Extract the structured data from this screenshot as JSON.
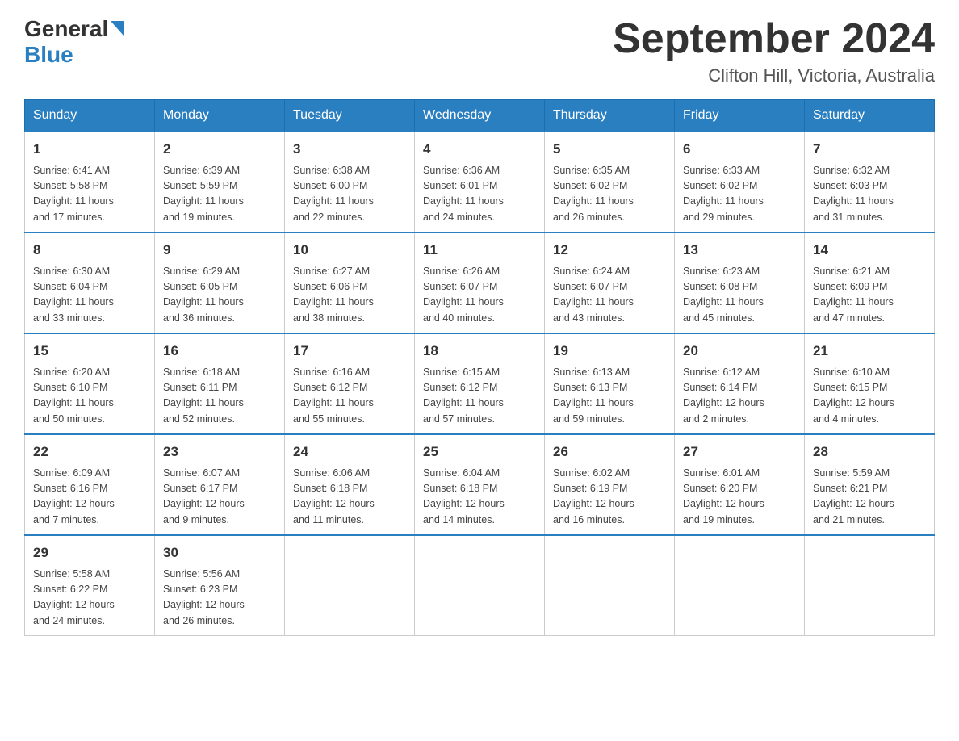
{
  "header": {
    "logo_general": "General",
    "logo_blue": "Blue",
    "month_title": "September 2024",
    "location": "Clifton Hill, Victoria, Australia"
  },
  "days_of_week": [
    "Sunday",
    "Monday",
    "Tuesday",
    "Wednesday",
    "Thursday",
    "Friday",
    "Saturday"
  ],
  "weeks": [
    [
      {
        "day": "1",
        "sunrise": "6:41 AM",
        "sunset": "5:58 PM",
        "daylight": "11 hours and 17 minutes."
      },
      {
        "day": "2",
        "sunrise": "6:39 AM",
        "sunset": "5:59 PM",
        "daylight": "11 hours and 19 minutes."
      },
      {
        "day": "3",
        "sunrise": "6:38 AM",
        "sunset": "6:00 PM",
        "daylight": "11 hours and 22 minutes."
      },
      {
        "day": "4",
        "sunrise": "6:36 AM",
        "sunset": "6:01 PM",
        "daylight": "11 hours and 24 minutes."
      },
      {
        "day": "5",
        "sunrise": "6:35 AM",
        "sunset": "6:02 PM",
        "daylight": "11 hours and 26 minutes."
      },
      {
        "day": "6",
        "sunrise": "6:33 AM",
        "sunset": "6:02 PM",
        "daylight": "11 hours and 29 minutes."
      },
      {
        "day": "7",
        "sunrise": "6:32 AM",
        "sunset": "6:03 PM",
        "daylight": "11 hours and 31 minutes."
      }
    ],
    [
      {
        "day": "8",
        "sunrise": "6:30 AM",
        "sunset": "6:04 PM",
        "daylight": "11 hours and 33 minutes."
      },
      {
        "day": "9",
        "sunrise": "6:29 AM",
        "sunset": "6:05 PM",
        "daylight": "11 hours and 36 minutes."
      },
      {
        "day": "10",
        "sunrise": "6:27 AM",
        "sunset": "6:06 PM",
        "daylight": "11 hours and 38 minutes."
      },
      {
        "day": "11",
        "sunrise": "6:26 AM",
        "sunset": "6:07 PM",
        "daylight": "11 hours and 40 minutes."
      },
      {
        "day": "12",
        "sunrise": "6:24 AM",
        "sunset": "6:07 PM",
        "daylight": "11 hours and 43 minutes."
      },
      {
        "day": "13",
        "sunrise": "6:23 AM",
        "sunset": "6:08 PM",
        "daylight": "11 hours and 45 minutes."
      },
      {
        "day": "14",
        "sunrise": "6:21 AM",
        "sunset": "6:09 PM",
        "daylight": "11 hours and 47 minutes."
      }
    ],
    [
      {
        "day": "15",
        "sunrise": "6:20 AM",
        "sunset": "6:10 PM",
        "daylight": "11 hours and 50 minutes."
      },
      {
        "day": "16",
        "sunrise": "6:18 AM",
        "sunset": "6:11 PM",
        "daylight": "11 hours and 52 minutes."
      },
      {
        "day": "17",
        "sunrise": "6:16 AM",
        "sunset": "6:12 PM",
        "daylight": "11 hours and 55 minutes."
      },
      {
        "day": "18",
        "sunrise": "6:15 AM",
        "sunset": "6:12 PM",
        "daylight": "11 hours and 57 minutes."
      },
      {
        "day": "19",
        "sunrise": "6:13 AM",
        "sunset": "6:13 PM",
        "daylight": "11 hours and 59 minutes."
      },
      {
        "day": "20",
        "sunrise": "6:12 AM",
        "sunset": "6:14 PM",
        "daylight": "12 hours and 2 minutes."
      },
      {
        "day": "21",
        "sunrise": "6:10 AM",
        "sunset": "6:15 PM",
        "daylight": "12 hours and 4 minutes."
      }
    ],
    [
      {
        "day": "22",
        "sunrise": "6:09 AM",
        "sunset": "6:16 PM",
        "daylight": "12 hours and 7 minutes."
      },
      {
        "day": "23",
        "sunrise": "6:07 AM",
        "sunset": "6:17 PM",
        "daylight": "12 hours and 9 minutes."
      },
      {
        "day": "24",
        "sunrise": "6:06 AM",
        "sunset": "6:18 PM",
        "daylight": "12 hours and 11 minutes."
      },
      {
        "day": "25",
        "sunrise": "6:04 AM",
        "sunset": "6:18 PM",
        "daylight": "12 hours and 14 minutes."
      },
      {
        "day": "26",
        "sunrise": "6:02 AM",
        "sunset": "6:19 PM",
        "daylight": "12 hours and 16 minutes."
      },
      {
        "day": "27",
        "sunrise": "6:01 AM",
        "sunset": "6:20 PM",
        "daylight": "12 hours and 19 minutes."
      },
      {
        "day": "28",
        "sunrise": "5:59 AM",
        "sunset": "6:21 PM",
        "daylight": "12 hours and 21 minutes."
      }
    ],
    [
      {
        "day": "29",
        "sunrise": "5:58 AM",
        "sunset": "6:22 PM",
        "daylight": "12 hours and 24 minutes."
      },
      {
        "day": "30",
        "sunrise": "5:56 AM",
        "sunset": "6:23 PM",
        "daylight": "12 hours and 26 minutes."
      },
      null,
      null,
      null,
      null,
      null
    ]
  ],
  "labels": {
    "sunrise": "Sunrise:",
    "sunset": "Sunset:",
    "daylight": "Daylight:"
  }
}
